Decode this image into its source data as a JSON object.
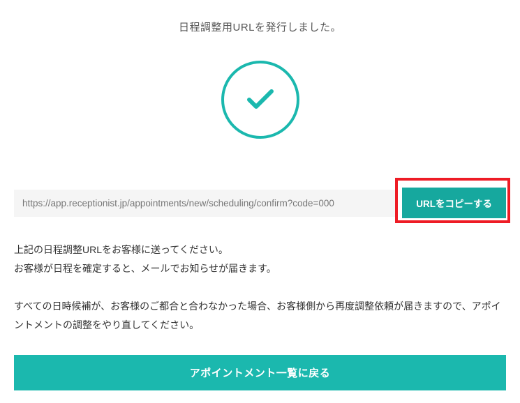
{
  "header": {
    "title": "日程調整用URLを発行しました。"
  },
  "url_section": {
    "url": "https://app.receptionist.jp/appointments/new/scheduling/confirm?code=000",
    "copy_label": "URLをコピーする"
  },
  "info": {
    "line1": "上記の日程調整URLをお客様に送ってください。",
    "line2": "お客様が日程を確定すると、メールでお知らせが届きます。",
    "line3": "すべての日時候補が、お客様のご都合と合わなかった場合、お客様側から再度調整依頼が届きますので、アポイントメントの調整をやり直してください。"
  },
  "actions": {
    "back_label": "アポイントメント一覧に戻る"
  },
  "colors": {
    "accent": "#1bb8ae",
    "highlight_border": "#ee1c25"
  }
}
